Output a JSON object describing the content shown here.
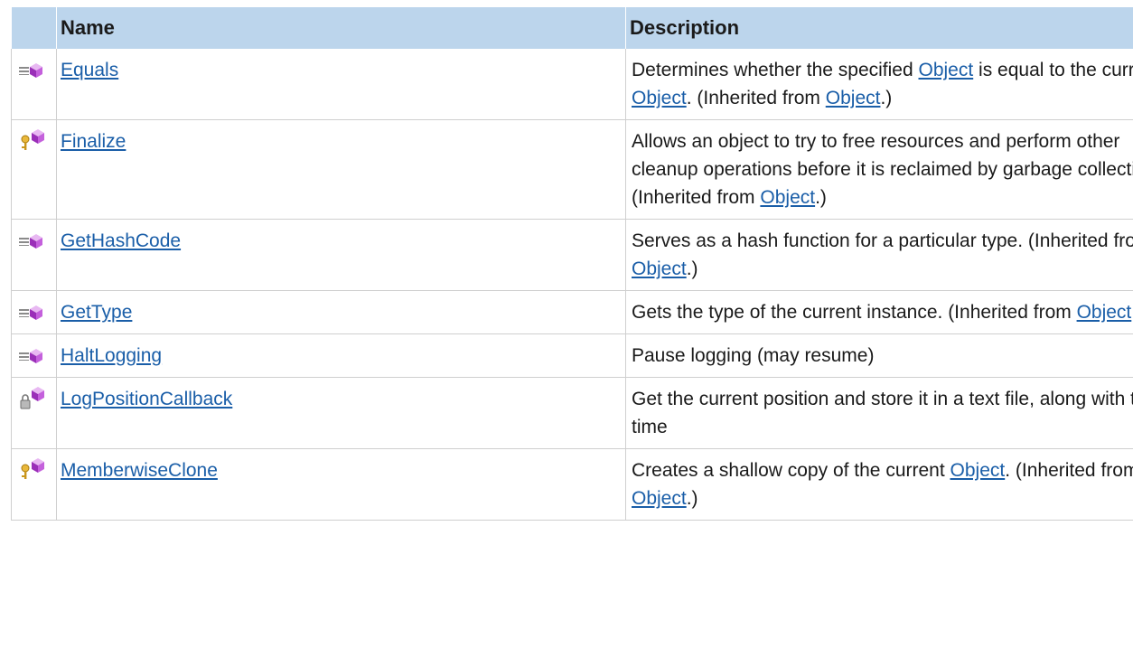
{
  "table": {
    "headers": {
      "name": "Name",
      "description": "Description"
    },
    "rows": [
      {
        "icon": "public-method-icon",
        "name": "Equals",
        "desc": [
          {
            "t": "Determines whether the specified "
          },
          {
            "link": "Object"
          },
          {
            "t": " is equal to the current "
          },
          {
            "link": "Object"
          },
          {
            "t": ". (Inherited from "
          },
          {
            "link": "Object"
          },
          {
            "t": ".)"
          }
        ]
      },
      {
        "icon": "protected-method-icon",
        "name": "Finalize",
        "desc": [
          {
            "t": "Allows an object to try to free resources and perform other cleanup operations before it is reclaimed by garbage collection. (Inherited from "
          },
          {
            "link": "Object"
          },
          {
            "t": ".)"
          }
        ]
      },
      {
        "icon": "public-method-icon",
        "name": "GetHashCode",
        "desc": [
          {
            "t": "Serves as a hash function for a particular type. (Inherited from "
          },
          {
            "link": "Object"
          },
          {
            "t": ".)"
          }
        ]
      },
      {
        "icon": "public-method-icon",
        "name": "GetType",
        "desc": [
          {
            "t": "Gets the type of the current instance. (Inherited from "
          },
          {
            "link": "Object"
          },
          {
            "t": ".)"
          }
        ]
      },
      {
        "icon": "public-method-icon",
        "name": "HaltLogging",
        "desc": [
          {
            "t": "Pause logging (may resume)"
          }
        ]
      },
      {
        "icon": "private-method-icon",
        "name": "LogPositionCallback",
        "desc": [
          {
            "t": "Get the current position and store it in a text file, along with the time"
          }
        ]
      },
      {
        "icon": "protected-method-icon",
        "name": "MemberwiseClone",
        "desc": [
          {
            "t": "Creates a shallow copy of the current "
          },
          {
            "link": "Object"
          },
          {
            "t": ". (Inherited from "
          },
          {
            "link": "Object"
          },
          {
            "t": ".)"
          }
        ]
      }
    ]
  }
}
